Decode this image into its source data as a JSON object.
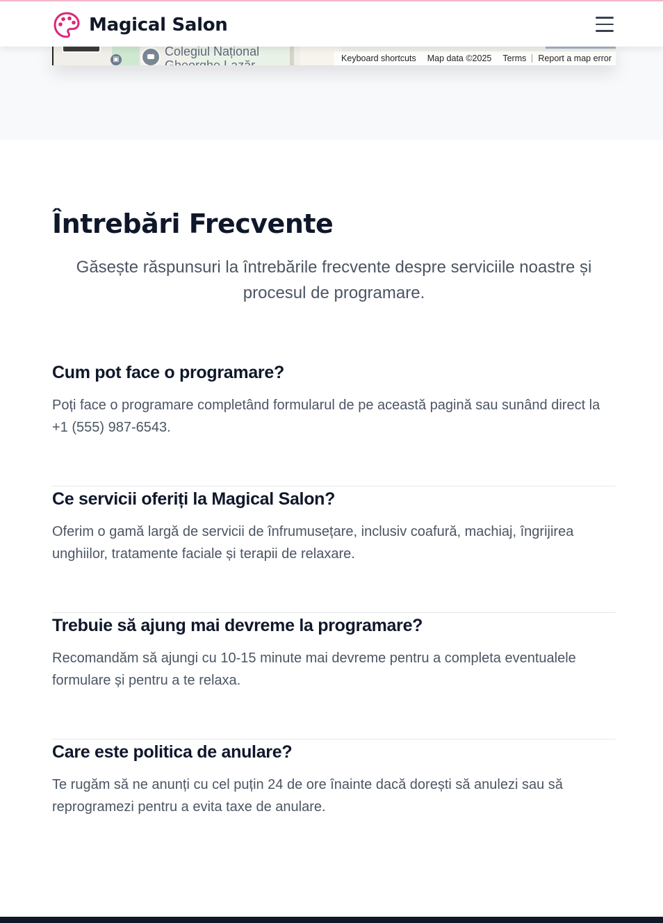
{
  "header": {
    "brand_name": "Magical Salon",
    "brand_icon": "palette-icon",
    "menu_icon": "hamburger-menu-icon",
    "brand_color": "#db2777"
  },
  "map": {
    "poi_label": "Colegiul Național",
    "poi_label_cut": "Gheorghe Lazăr",
    "footer": {
      "shortcuts": "Keyboard shortcuts",
      "map_data": "Map data ©2025",
      "terms": "Terms",
      "report": "Report a map error"
    }
  },
  "faq": {
    "title": "Întrebări Frecvente",
    "subtitle": "Găsește răspunsuri la întrebările frecvente despre serviciile noastre și procesul de programare.",
    "items": [
      {
        "question": "Cum pot face o programare?",
        "answer": "Poți face o programare completând formularul de pe această pagină sau sunând direct la +1 (555) 987-6543."
      },
      {
        "question": "Ce servicii oferiți la Magical Salon?",
        "answer": "Oferim o gamă largă de servicii de înfrumusețare, inclusiv coafură, machiaj, îngrijirea unghiilor, tratamente faciale și terapii de relaxare."
      },
      {
        "question": "Trebuie să ajung mai devreme la programare?",
        "answer": "Recomandăm să ajungi cu 10-15 minute mai devreme pentru a completa eventualele formulare și pentru a te relaxa."
      },
      {
        "question": "Care este politica de anulare?",
        "answer": "Te rugăm să ne anunți cu cel puțin 24 de ore înainte dacă dorești să anulezi sau să reprogramezi pentru a evita taxe de anulare."
      }
    ]
  }
}
